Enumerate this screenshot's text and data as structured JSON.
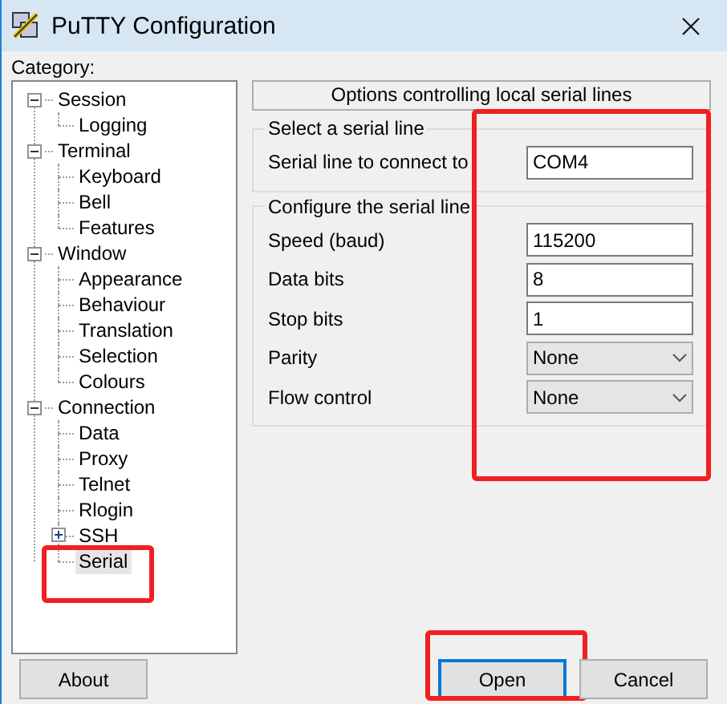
{
  "window": {
    "title": "PuTTY Configuration"
  },
  "category_label": "Category:",
  "tree": [
    {
      "label": "Session",
      "expanded": true,
      "selected": false,
      "children": [
        {
          "label": "Logging",
          "selected": false
        }
      ]
    },
    {
      "label": "Terminal",
      "expanded": true,
      "selected": false,
      "children": [
        {
          "label": "Keyboard",
          "selected": false
        },
        {
          "label": "Bell",
          "selected": false
        },
        {
          "label": "Features",
          "selected": false
        }
      ]
    },
    {
      "label": "Window",
      "expanded": true,
      "selected": false,
      "children": [
        {
          "label": "Appearance",
          "selected": false
        },
        {
          "label": "Behaviour",
          "selected": false
        },
        {
          "label": "Translation",
          "selected": false
        },
        {
          "label": "Selection",
          "selected": false
        },
        {
          "label": "Colours",
          "selected": false
        }
      ]
    },
    {
      "label": "Connection",
      "expanded": true,
      "selected": false,
      "children": [
        {
          "label": "Data",
          "selected": false
        },
        {
          "label": "Proxy",
          "selected": false
        },
        {
          "label": "Telnet",
          "selected": false
        },
        {
          "label": "Rlogin",
          "selected": false
        },
        {
          "label": "SSH",
          "expanded": false,
          "selected": false
        },
        {
          "label": "Serial",
          "selected": true,
          "highlighted": true
        }
      ]
    }
  ],
  "panel": {
    "header": "Options controlling local serial lines",
    "values_highlighted": true,
    "groups": [
      {
        "title": "Select a serial line",
        "fields": [
          {
            "kind": "text",
            "label": "Serial line to connect to",
            "value": "COM4"
          }
        ]
      },
      {
        "title": "Configure the serial line",
        "fields": [
          {
            "kind": "text",
            "label": "Speed (baud)",
            "value": "115200"
          },
          {
            "kind": "text",
            "label": "Data bits",
            "value": "8"
          },
          {
            "kind": "text",
            "label": "Stop bits",
            "value": "1"
          },
          {
            "kind": "dropdown",
            "label": "Parity",
            "value": "None"
          },
          {
            "kind": "dropdown",
            "label": "Flow control",
            "value": "None"
          }
        ]
      }
    ]
  },
  "buttons": [
    {
      "label": "About",
      "default": false,
      "highlighted": false
    },
    {
      "label": "Open",
      "default": true,
      "highlighted": true
    },
    {
      "label": "Cancel",
      "default": false,
      "highlighted": false
    }
  ]
}
